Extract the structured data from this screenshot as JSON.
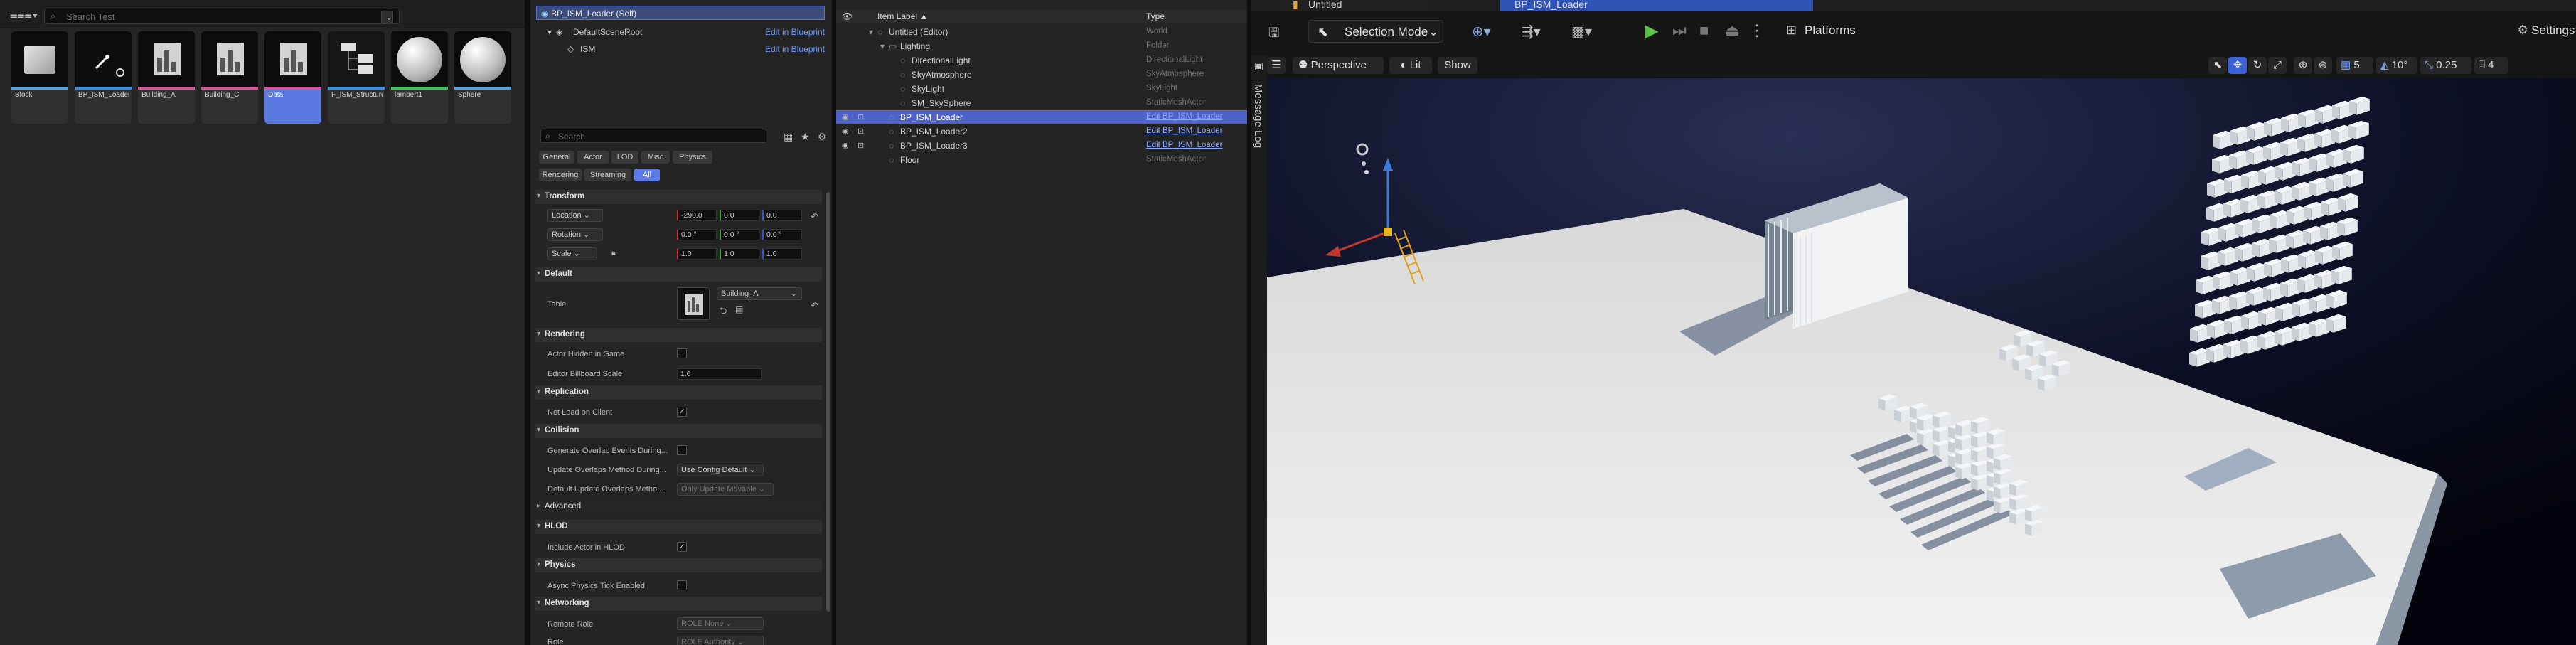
{
  "content_browser": {
    "search_placeholder": "Search Test",
    "assets": [
      {
        "label": "Block",
        "kind": "cube",
        "color": "#5aa0d0"
      },
      {
        "label": "BP_ISM_Loader",
        "kind": "bp",
        "color": "#3a8fe0"
      },
      {
        "label": "Building_A",
        "kind": "table",
        "color": "#d05a9a"
      },
      {
        "label": "Building_C",
        "kind": "table",
        "color": "#d05a9a"
      },
      {
        "label": "Data",
        "kind": "table",
        "color": "#d05a9a"
      },
      {
        "label": "F_ISM_Structure",
        "kind": "struct",
        "color": "#3a8fe0"
      },
      {
        "label": "lambert1",
        "kind": "sphere",
        "color": "#45c060"
      },
      {
        "label": "Sphere",
        "kind": "sphere",
        "color": "#5aa0d0"
      }
    ]
  },
  "details": {
    "actor_title": "BP_ISM_Loader (Self)",
    "components": [
      {
        "name": "DefaultSceneRoot",
        "link": "Edit in Blueprint"
      },
      {
        "name": "ISM",
        "link": "Edit in Blueprint"
      }
    ],
    "search_placeholder": "Search",
    "filter_tabs_row1": [
      "General",
      "Actor",
      "LOD",
      "Misc",
      "Physics"
    ],
    "filter_tabs_row2": [
      "Rendering",
      "Streaming",
      "All"
    ],
    "sections": {
      "transform": "Transform",
      "default": "Default",
      "rendering": "Rendering",
      "replication": "Replication",
      "collision": "Collision",
      "advanced": "Advanced",
      "hlod": "HLOD",
      "physics": "Physics",
      "networking": "Networking"
    },
    "transform": {
      "location_label": "Location",
      "rotation_label": "Rotation",
      "scale_label": "Scale",
      "location": [
        "-290.0",
        "0.0",
        "0.0"
      ],
      "rotation": [
        "0.0 °",
        "0.0 °",
        "0.0 °"
      ],
      "scale": [
        "1.0",
        "1.0",
        "1.0"
      ]
    },
    "default": {
      "table_label": "Table",
      "table_value": "Building_A"
    },
    "rendering": {
      "hidden_label": "Actor Hidden in Game",
      "billboard_label": "Editor Billboard Scale",
      "billboard_value": "1.0"
    },
    "replication": {
      "net_load_label": "Net Load on Client"
    },
    "collision": {
      "gen_overlap_label": "Generate Overlap Events During...",
      "update_overlap_label": "Update Overlaps Method During...",
      "update_overlap_value": "Use Config Default",
      "default_update_label": "Default Update Overlaps Metho...",
      "default_update_value": "Only Update Movable"
    },
    "hlod": {
      "include_label": "Include Actor in HLOD"
    },
    "physics": {
      "async_label": "Async Physics Tick Enabled"
    },
    "networking": {
      "remote_role_label": "Remote Role",
      "remote_role_value": "ROLE None",
      "role_label": "Role",
      "role_value": "ROLE Authority"
    }
  },
  "outliner": {
    "col_label": "Item Label ▲",
    "col_type": "Type",
    "rows": [
      {
        "name": "Untitled (Editor)",
        "type": "World",
        "indent": 0,
        "link": false,
        "sel": false
      },
      {
        "name": "Lighting",
        "type": "Folder",
        "indent": 1,
        "link": false,
        "sel": false
      },
      {
        "name": "DirectionalLight",
        "type": "DirectionalLight",
        "indent": 2,
        "link": false,
        "sel": false
      },
      {
        "name": "SkyAtmosphere",
        "type": "SkyAtmosphere",
        "indent": 2,
        "link": false,
        "sel": false
      },
      {
        "name": "SkyLight",
        "type": "SkyLight",
        "indent": 2,
        "link": false,
        "sel": false
      },
      {
        "name": "SM_SkySphere",
        "type": "StaticMeshActor",
        "indent": 2,
        "link": false,
        "sel": false
      },
      {
        "name": "BP_ISM_Loader",
        "type": "Edit BP_ISM_Loader",
        "indent": 1,
        "link": true,
        "sel": true
      },
      {
        "name": "BP_ISM_Loader2",
        "type": "Edit BP_ISM_Loader",
        "indent": 1,
        "link": true,
        "sel": false
      },
      {
        "name": "BP_ISM_Loader3",
        "type": "Edit BP_ISM_Loader",
        "indent": 1,
        "link": true,
        "sel": false
      },
      {
        "name": "Floor",
        "type": "StaticMeshActor",
        "indent": 1,
        "link": false,
        "sel": false
      }
    ]
  },
  "viewport": {
    "tab_title": "Untitled",
    "tab2_title": "BP_ISM_Loader",
    "selection_mode": "Selection Mode",
    "platforms": "Platforms",
    "settings": "Settings",
    "perspective": "Perspective",
    "lit": "Lit",
    "show": "Show",
    "grid_snap": "5",
    "rot_snap": "10°",
    "scale_snap": "0.25",
    "cam_speed": "4",
    "message_log": "Message Log"
  }
}
